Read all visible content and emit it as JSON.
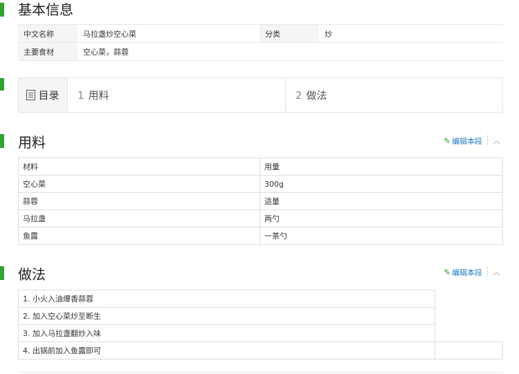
{
  "basic_info": {
    "title": "基本信息",
    "rows": [
      [
        "中文名称",
        "马拉盏炒空心菜",
        "分类",
        "炒"
      ],
      [
        "主要食材",
        "空心菜，蒜蓉",
        "",
        ""
      ]
    ]
  },
  "toc": {
    "head_icon": "list-icon",
    "head_label": "目录",
    "items": [
      {
        "num": "1",
        "label": "用料"
      },
      {
        "num": "2",
        "label": "做法"
      }
    ]
  },
  "ingredients": {
    "title": "用料",
    "edit_label": "编辑本段",
    "header": [
      "材料",
      "用量"
    ],
    "rows": [
      [
        "空心菜",
        "300g"
      ],
      [
        "蒜蓉",
        "适量"
      ],
      [
        "马拉盏",
        "两勺"
      ],
      [
        "鱼露",
        "一茶勺"
      ]
    ]
  },
  "steps": {
    "title": "做法",
    "edit_label": "编辑本段",
    "items": [
      "1. 小火入油爆香蒜蓉",
      "2. 加入空心菜炒至断生",
      "3. 加入马拉盏翻炒入味",
      "4. 出锅前加入鱼露即可"
    ]
  },
  "colors": {
    "accent_bar": "#2fa42f",
    "link": "#1f7ac9"
  }
}
